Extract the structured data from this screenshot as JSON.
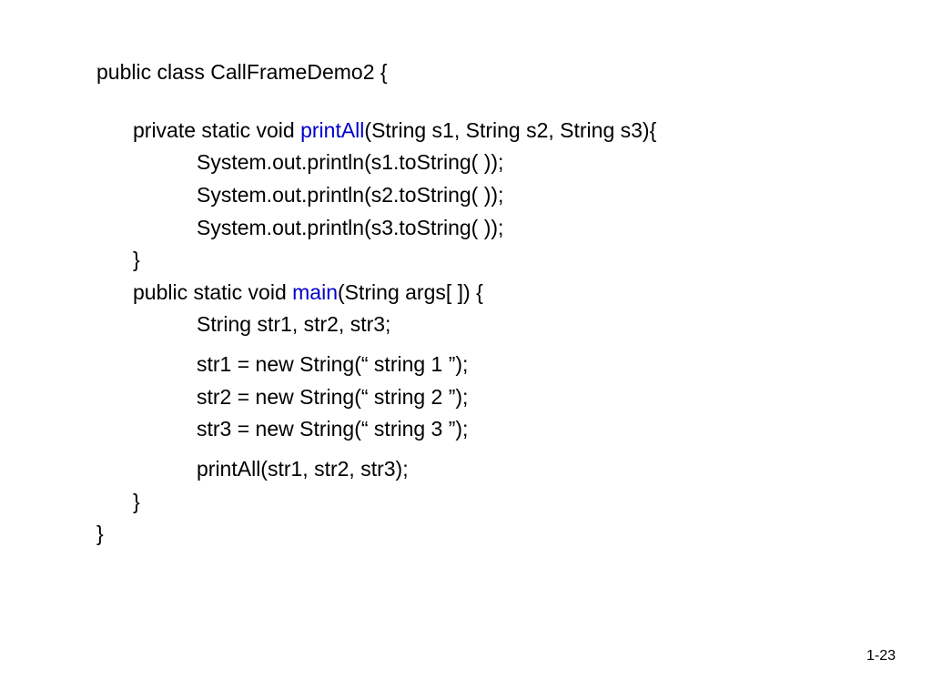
{
  "code": {
    "line0": "public class CallFrameDemo2 {",
    "line1_pre": "private static void ",
    "line1_method": "printAll",
    "line1_post": "(String s1, String s2, String s3){",
    "line2": "System.out.println(s1.toString( ));",
    "line3": "System.out.println(s2.toString( ));",
    "line4": "System.out.println(s3.toString( ));",
    "line5": "}",
    "line6_pre": "public static void ",
    "line6_method": "main",
    "line6_post": "(String args[ ]) {",
    "line7": "String str1, str2, str3;",
    "line8": "str1 = new String(“ string 1 ”);",
    "line9": "str2 = new String(“ string 2 ”);",
    "line10": "str3 = new String(“ string 3 ”);",
    "line11": "printAll(str1, str2, str3);",
    "line12": "}",
    "line13": "}"
  },
  "page": "1-23"
}
